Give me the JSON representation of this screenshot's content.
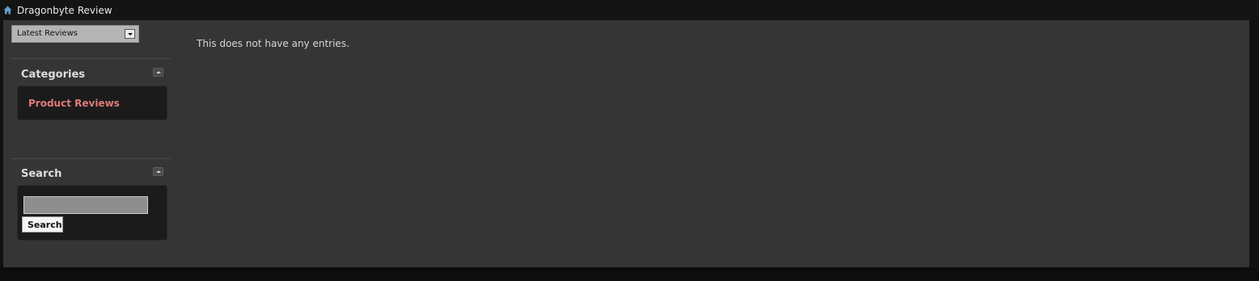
{
  "header": {
    "title": "Dragonbyte Review",
    "home_icon": "home-icon"
  },
  "view_select": {
    "selected": "Latest Reviews"
  },
  "categories": {
    "title": "Categories",
    "items": [
      {
        "label": "Product Reviews"
      }
    ]
  },
  "search": {
    "title": "Search",
    "input_value": "",
    "button_label": "Search"
  },
  "main": {
    "empty_message": "This does not have any entries."
  },
  "colors": {
    "background": "#111111",
    "panel": "#353535",
    "category_link": "#e07b7b"
  }
}
